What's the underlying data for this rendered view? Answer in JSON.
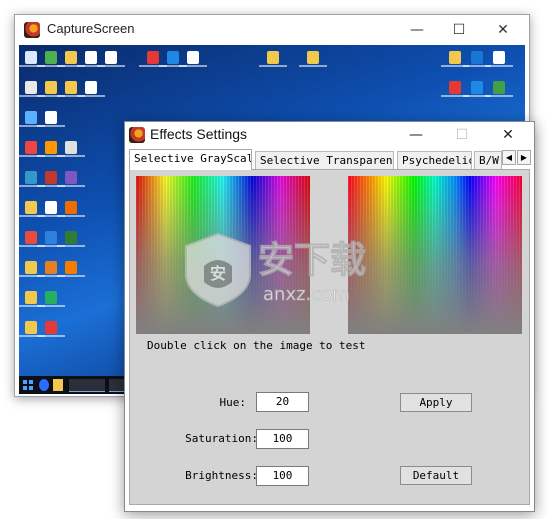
{
  "back_window": {
    "title": "CaptureScreen",
    "controls": {
      "minimize": "—",
      "maximize": "☐",
      "close": "✕"
    }
  },
  "front_window": {
    "title": "Effects Settings",
    "controls": {
      "minimize": "—",
      "maximize": "☐",
      "close": "✕"
    },
    "tabs": [
      "Selective GrayScale",
      "Selective Transparent",
      "Psychedelic",
      "B/W."
    ],
    "active_tab": "Selective GrayScale",
    "tab_scroll": {
      "left": "◀",
      "right": "▶"
    },
    "hint": "Double click on the image to test",
    "fields": {
      "hue": {
        "label": "Hue:",
        "value": "20"
      },
      "saturation": {
        "label": "Saturation:",
        "value": "100"
      },
      "brightness": {
        "label": "Brightness:",
        "value": "100"
      }
    },
    "buttons": {
      "apply": "Apply",
      "default": "Default"
    }
  },
  "watermark": {
    "title": "安下载",
    "url": "anxz.com"
  }
}
